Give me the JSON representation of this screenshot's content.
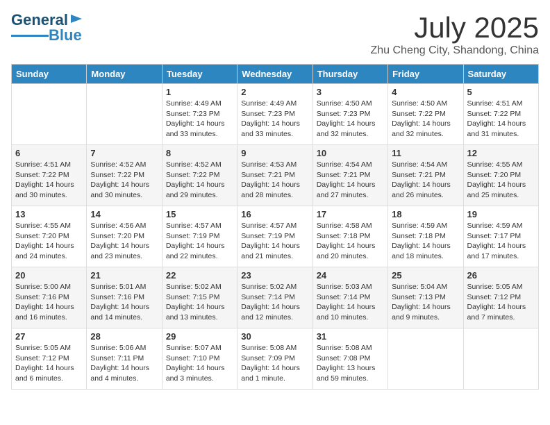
{
  "header": {
    "logo_line1": "General",
    "logo_line2": "Blue",
    "month": "July 2025",
    "location": "Zhu Cheng City, Shandong, China"
  },
  "days_of_week": [
    "Sunday",
    "Monday",
    "Tuesday",
    "Wednesday",
    "Thursday",
    "Friday",
    "Saturday"
  ],
  "weeks": [
    [
      {
        "day": "",
        "info": ""
      },
      {
        "day": "",
        "info": ""
      },
      {
        "day": "1",
        "info": "Sunrise: 4:49 AM\nSunset: 7:23 PM\nDaylight: 14 hours\nand 33 minutes."
      },
      {
        "day": "2",
        "info": "Sunrise: 4:49 AM\nSunset: 7:23 PM\nDaylight: 14 hours\nand 33 minutes."
      },
      {
        "day": "3",
        "info": "Sunrise: 4:50 AM\nSunset: 7:23 PM\nDaylight: 14 hours\nand 32 minutes."
      },
      {
        "day": "4",
        "info": "Sunrise: 4:50 AM\nSunset: 7:22 PM\nDaylight: 14 hours\nand 32 minutes."
      },
      {
        "day": "5",
        "info": "Sunrise: 4:51 AM\nSunset: 7:22 PM\nDaylight: 14 hours\nand 31 minutes."
      }
    ],
    [
      {
        "day": "6",
        "info": "Sunrise: 4:51 AM\nSunset: 7:22 PM\nDaylight: 14 hours\nand 30 minutes."
      },
      {
        "day": "7",
        "info": "Sunrise: 4:52 AM\nSunset: 7:22 PM\nDaylight: 14 hours\nand 30 minutes."
      },
      {
        "day": "8",
        "info": "Sunrise: 4:52 AM\nSunset: 7:22 PM\nDaylight: 14 hours\nand 29 minutes."
      },
      {
        "day": "9",
        "info": "Sunrise: 4:53 AM\nSunset: 7:21 PM\nDaylight: 14 hours\nand 28 minutes."
      },
      {
        "day": "10",
        "info": "Sunrise: 4:54 AM\nSunset: 7:21 PM\nDaylight: 14 hours\nand 27 minutes."
      },
      {
        "day": "11",
        "info": "Sunrise: 4:54 AM\nSunset: 7:21 PM\nDaylight: 14 hours\nand 26 minutes."
      },
      {
        "day": "12",
        "info": "Sunrise: 4:55 AM\nSunset: 7:20 PM\nDaylight: 14 hours\nand 25 minutes."
      }
    ],
    [
      {
        "day": "13",
        "info": "Sunrise: 4:55 AM\nSunset: 7:20 PM\nDaylight: 14 hours\nand 24 minutes."
      },
      {
        "day": "14",
        "info": "Sunrise: 4:56 AM\nSunset: 7:20 PM\nDaylight: 14 hours\nand 23 minutes."
      },
      {
        "day": "15",
        "info": "Sunrise: 4:57 AM\nSunset: 7:19 PM\nDaylight: 14 hours\nand 22 minutes."
      },
      {
        "day": "16",
        "info": "Sunrise: 4:57 AM\nSunset: 7:19 PM\nDaylight: 14 hours\nand 21 minutes."
      },
      {
        "day": "17",
        "info": "Sunrise: 4:58 AM\nSunset: 7:18 PM\nDaylight: 14 hours\nand 20 minutes."
      },
      {
        "day": "18",
        "info": "Sunrise: 4:59 AM\nSunset: 7:18 PM\nDaylight: 14 hours\nand 18 minutes."
      },
      {
        "day": "19",
        "info": "Sunrise: 4:59 AM\nSunset: 7:17 PM\nDaylight: 14 hours\nand 17 minutes."
      }
    ],
    [
      {
        "day": "20",
        "info": "Sunrise: 5:00 AM\nSunset: 7:16 PM\nDaylight: 14 hours\nand 16 minutes."
      },
      {
        "day": "21",
        "info": "Sunrise: 5:01 AM\nSunset: 7:16 PM\nDaylight: 14 hours\nand 14 minutes."
      },
      {
        "day": "22",
        "info": "Sunrise: 5:02 AM\nSunset: 7:15 PM\nDaylight: 14 hours\nand 13 minutes."
      },
      {
        "day": "23",
        "info": "Sunrise: 5:02 AM\nSunset: 7:14 PM\nDaylight: 14 hours\nand 12 minutes."
      },
      {
        "day": "24",
        "info": "Sunrise: 5:03 AM\nSunset: 7:14 PM\nDaylight: 14 hours\nand 10 minutes."
      },
      {
        "day": "25",
        "info": "Sunrise: 5:04 AM\nSunset: 7:13 PM\nDaylight: 14 hours\nand 9 minutes."
      },
      {
        "day": "26",
        "info": "Sunrise: 5:05 AM\nSunset: 7:12 PM\nDaylight: 14 hours\nand 7 minutes."
      }
    ],
    [
      {
        "day": "27",
        "info": "Sunrise: 5:05 AM\nSunset: 7:12 PM\nDaylight: 14 hours\nand 6 minutes."
      },
      {
        "day": "28",
        "info": "Sunrise: 5:06 AM\nSunset: 7:11 PM\nDaylight: 14 hours\nand 4 minutes."
      },
      {
        "day": "29",
        "info": "Sunrise: 5:07 AM\nSunset: 7:10 PM\nDaylight: 14 hours\nand 3 minutes."
      },
      {
        "day": "30",
        "info": "Sunrise: 5:08 AM\nSunset: 7:09 PM\nDaylight: 14 hours\nand 1 minute."
      },
      {
        "day": "31",
        "info": "Sunrise: 5:08 AM\nSunset: 7:08 PM\nDaylight: 13 hours\nand 59 minutes."
      },
      {
        "day": "",
        "info": ""
      },
      {
        "day": "",
        "info": ""
      }
    ]
  ]
}
